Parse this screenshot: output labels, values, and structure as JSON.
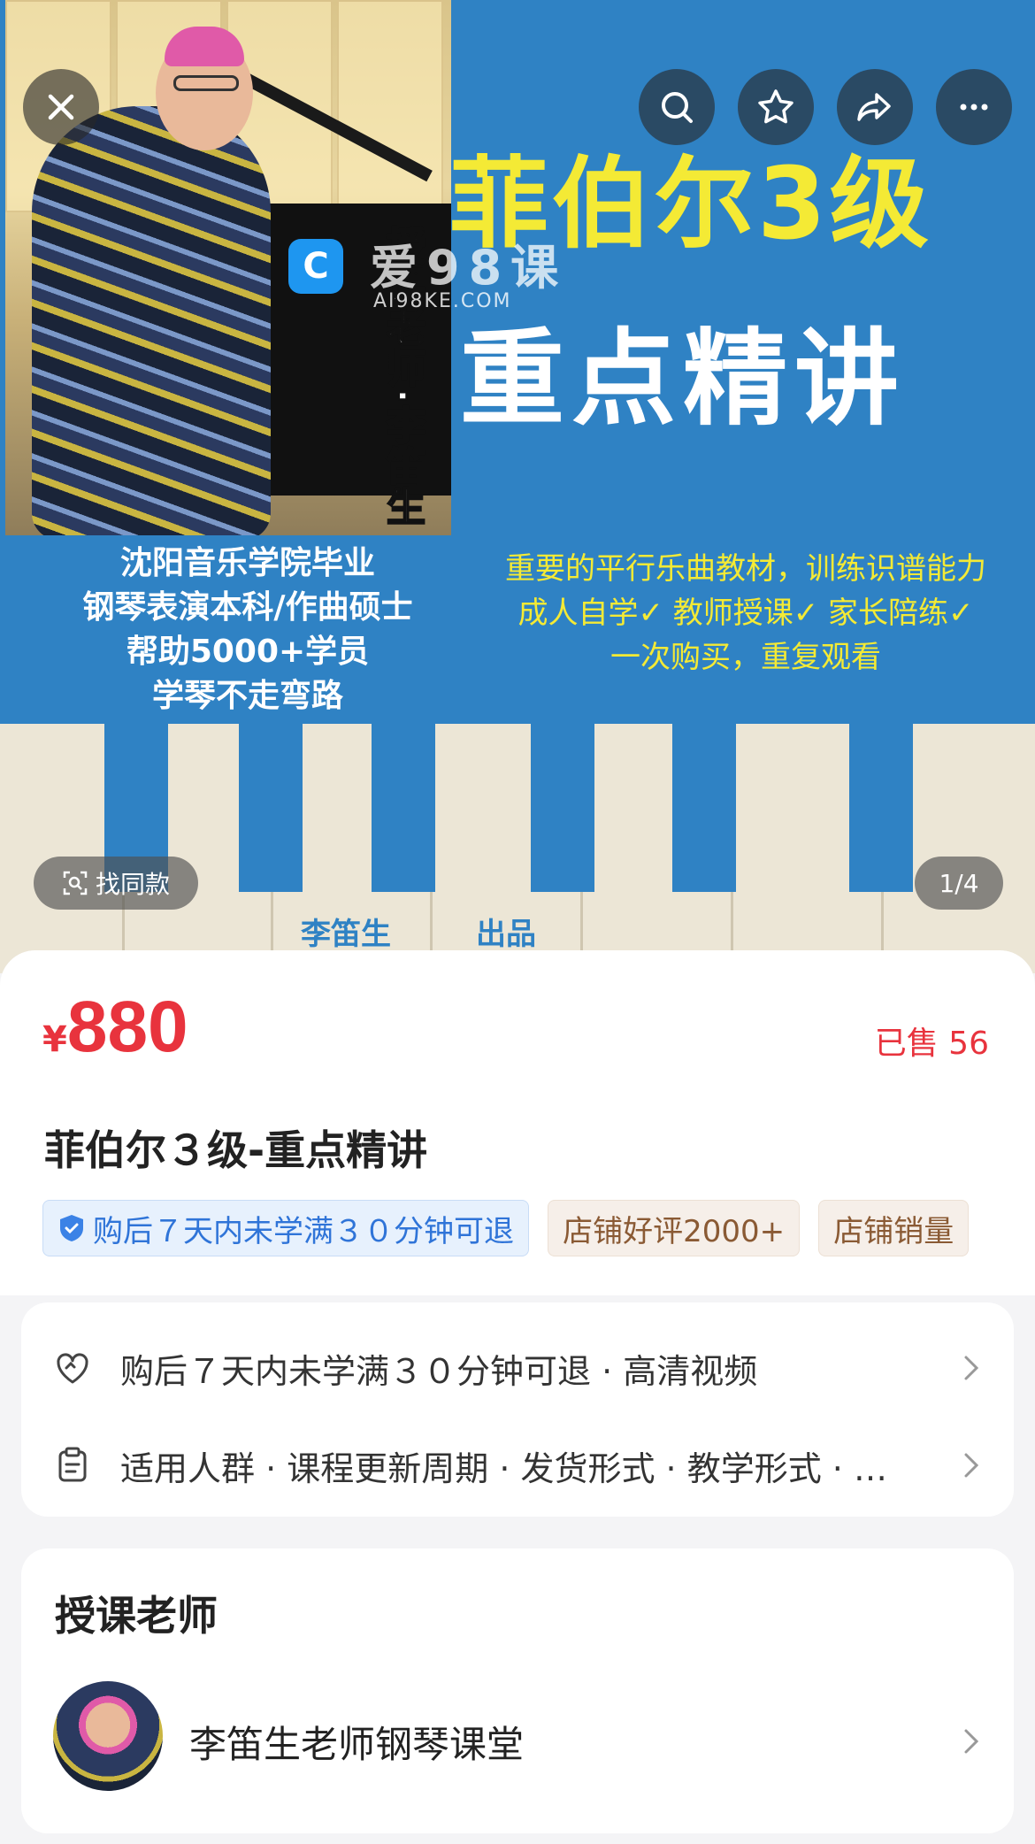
{
  "hero": {
    "title_line1": "菲伯尔3级",
    "title_line2": "重点精讲",
    "teacher_vertical": "授课老师·李笛生",
    "left_lines": [
      "沈阳音乐学院毕业",
      "钢琴表演本科/作曲硕士",
      "帮助5000+学员",
      "学琴不走弯路"
    ],
    "right_lines": [
      "重要的平行乐曲教材，训练识谱能力",
      "成人自学✓ 教师授课✓ 家长陪练✓",
      "一次购买，重复观看"
    ],
    "key_label_1": "李笛生",
    "key_label_2": "出品",
    "watermark_text": "爱98课",
    "watermark_url": "AI98KE.COM",
    "find_similar": "找同款",
    "image_counter": "1/4"
  },
  "topbar": {
    "close_icon": "close-icon",
    "search_icon": "search-icon",
    "favorite_icon": "star-icon",
    "share_icon": "share-icon",
    "more_icon": "more-icon"
  },
  "product": {
    "currency": "¥",
    "price": "880",
    "sold": "已售 56",
    "title": "菲伯尔３级-重点精讲",
    "tags": [
      "购后７天内未学满３０分钟可退",
      "店铺好评2000+",
      "店铺销量"
    ]
  },
  "service": {
    "row1": "购后７天内未学满３０分钟可退 · 高清视频",
    "row2": "适用人群 · 课程更新周期 · 发货形式 · 教学形式 · …"
  },
  "teacher": {
    "section_title": "授课老师",
    "name": "李笛生老师钢琴课堂"
  },
  "colors": {
    "accent_red": "#e8333d",
    "banner_blue": "#2f82c4",
    "banner_yellow": "#f4ea35",
    "tag_blue": "#2f74d8",
    "tag_brown": "#8a5a34"
  }
}
